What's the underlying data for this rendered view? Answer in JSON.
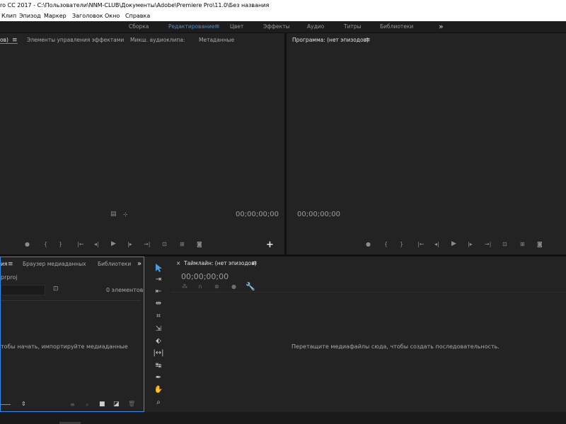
{
  "titlebar": {
    "text": "ro CC 2017 - C:\\Пользователи\\NNM-CLUB\\Документы\\Adobe\\Premiere Pro\\11.0\\Без названия"
  },
  "menubar": {
    "items": [
      "Клип",
      "Эпизод",
      "Маркер",
      "Заголовок",
      "Окно",
      "Справка"
    ]
  },
  "workspaces": {
    "items": [
      "Сборка",
      "Редактирование",
      "Цвет",
      "Эффекты",
      "Аудио",
      "Титры",
      "Библиотеки"
    ],
    "active": "Редактирование",
    "accent": "#4a90d9",
    "more": "»"
  },
  "source_panel": {
    "tabs": [
      "ов)",
      "Элементы управления эффектами",
      "Микш. аудиоклипа:",
      "Метаданные"
    ],
    "timecode": "00;00;00;00",
    "add": "+"
  },
  "program_panel": {
    "title": "Программа: (нет эпизодов)",
    "timecode": "00;00;00;00"
  },
  "project_panel": {
    "tabs": [
      "ия",
      "Браузер медиаданных",
      "Библиотеки"
    ],
    "more": "»",
    "project_file": "prproj",
    "item_count": "0 элементов",
    "hint": "тобы начать, импортируйте медиаданные",
    "border_color": "#2d8ceb"
  },
  "timeline_panel": {
    "close": "×",
    "title": "Таймлайн: (нет эпизодов)",
    "timecode": "00;00;00;00",
    "drop_hint": "Перетащите медиафайлы сюда, чтобы создать последовательность."
  },
  "icons": {
    "menu": "≡",
    "selection": "selection-tool-icon",
    "wrench": "wrench-icon"
  }
}
